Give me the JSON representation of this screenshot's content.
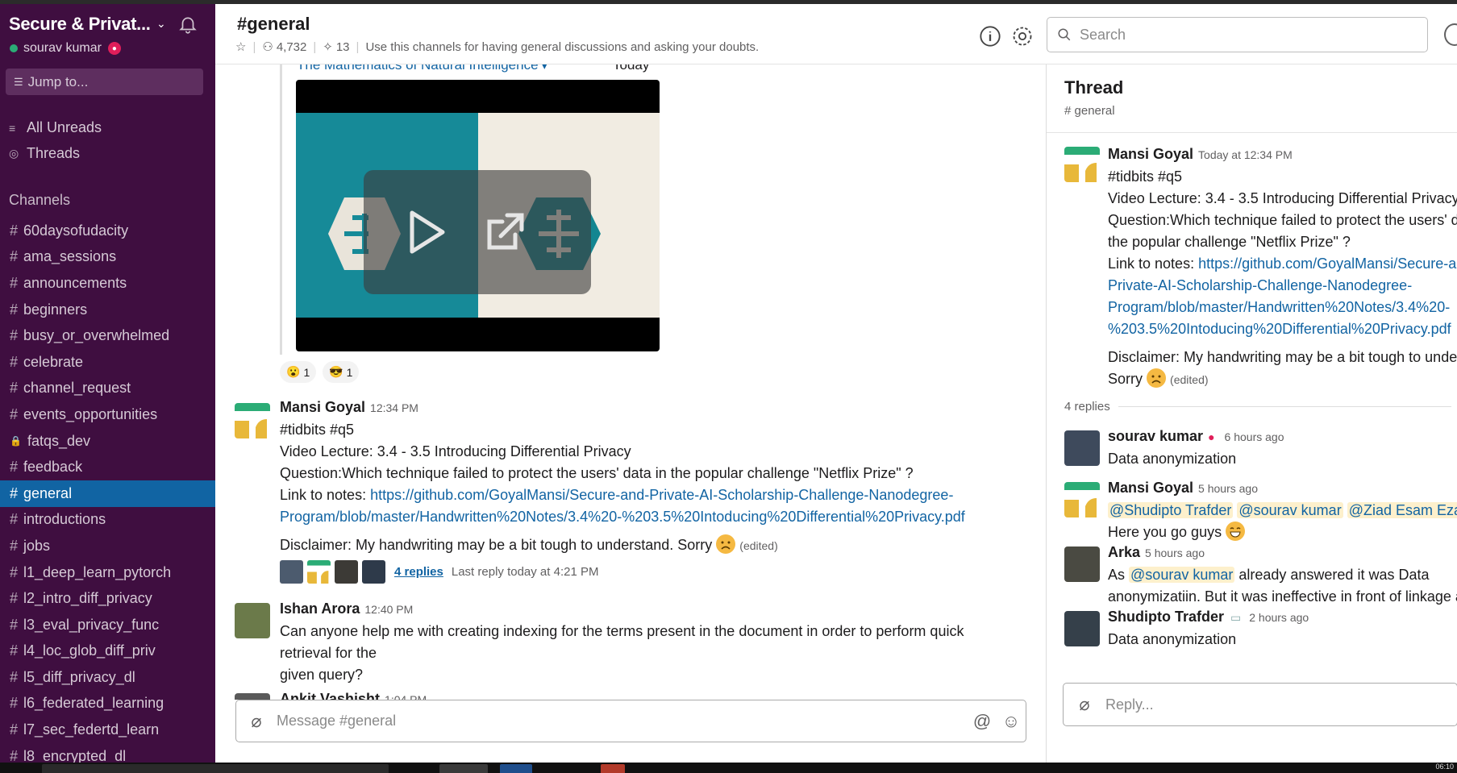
{
  "workspace": {
    "name": "Secure & Privat...",
    "user": "sourav kumar"
  },
  "sidebar": {
    "jump_label": "Jump to...",
    "nav": [
      "All Unreads",
      "Threads"
    ],
    "channels_title": "Channels",
    "channels": [
      "60daysofudacity",
      "ama_sessions",
      "announcements",
      "beginners",
      "busy_or_overwhelmed",
      "celebrate",
      "channel_request",
      "events_opportunities",
      "fatqs_dev",
      "feedback",
      "general",
      "introductions",
      "jobs",
      "l1_deep_learn_pytorch",
      "l2_intro_diff_privacy",
      "l3_eval_privacy_func",
      "l4_loc_glob_diff_priv",
      "l5_diff_privacy_dl",
      "l6_federated_learning",
      "l7_sec_federtd_learn",
      "l8_encrypted_dl"
    ],
    "active_channel": "general",
    "private_channel": "fatqs_dev"
  },
  "header": {
    "channel": "#general",
    "members": "4,732",
    "pins": "13",
    "topic": "Use this channels for having general discussions and asking your doubts.",
    "search_placeholder": "Search"
  },
  "messages": {
    "video": {
      "title": "The Mathematics of Natural Intelligence",
      "date": "Today"
    },
    "reactions": [
      {
        "emoji": "😮",
        "count": "1"
      },
      {
        "emoji": "😎",
        "count": "1"
      }
    ],
    "m1": {
      "sender": "Mansi Goyal",
      "time": "12:34 PM",
      "line1": "#tidbits #q5",
      "line2": "Video Lecture: 3.4 - 3.5 Introducing Differential Privacy",
      "line3": "Question:Which technique failed to protect the users' data in the popular challenge \"Netflix Prize\" ?",
      "link_prefix": "Link to notes: ",
      "link_a": "https://github.com/GoyalMansi/Secure-and-Private-AI-Scholarship-Challenge-Nanodegree-",
      "link_b": "Program/blob/master/Handwritten%20Notes/3.4%20-%203.5%20Intoducing%20Differential%20Privacy.pdf",
      "disclaimer": "Disclaimer: My handwriting may be a bit tough to understand. Sorry",
      "edited": "(edited)",
      "replies": "4 replies",
      "last_reply": "Last reply today at 4:21 PM"
    },
    "m2": {
      "sender": "Ishan Arora",
      "time": "12:40 PM",
      "text1": "Can anyone help me with creating indexing for the terms present in the document in order to perform quick",
      "text2": "retrieval for the",
      "text3": "given query?"
    },
    "m3": {
      "sender": "Ankit Vashisht",
      "time": "1:04 PM"
    },
    "composer_placeholder": "Message #general"
  },
  "thread": {
    "title": "Thread",
    "channel": "# general",
    "parent": {
      "sender": "Mansi Goyal",
      "time": "Today at 12:34 PM",
      "line1": "#tidbits #q5",
      "line2": "Video Lecture: 3.4 - 3.5 Introducing Differential Privacy",
      "line3": "Question:Which technique failed to protect the users' data in",
      "line4": "the popular challenge \"Netflix Prize\" ?",
      "link_prefix": "Link to notes: ",
      "link_a": "https://github.com/GoyalMansi/Secure-and-",
      "link_b": "Private-AI-Scholarship-Challenge-Nanodegree-",
      "link_c": "Program/blob/master/Handwritten%20Notes/3.4%20-",
      "link_d": "%203.5%20Intoducing%20Differential%20Privacy.pdf",
      "disclaimer": "Disclaimer: My handwriting may be a bit tough to understand.",
      "sorry": "Sorry",
      "edited": "(edited)"
    },
    "replies_count": "4 replies",
    "replies": [
      {
        "sender": "sourav kumar",
        "time": "6 hours ago",
        "text": "Data anonymization"
      },
      {
        "sender": "Mansi Goyal",
        "time": "5 hours ago",
        "mentions": [
          "@Shudipto Trafder",
          "@sourav kumar",
          "@Ziad Esam Ezat"
        ],
        "text": "Here you go guys"
      },
      {
        "sender": "Arka",
        "time": "5 hours ago",
        "pre": "As",
        "mention": "@sourav kumar",
        "post": "already answered it was Data",
        "line2": "anonymizatiin. But it was ineffective in front of linkage attack."
      },
      {
        "sender": "Shudipto Trafder",
        "time": "2 hours ago",
        "text": "Data anonymization"
      }
    ],
    "reply_placeholder": "Reply..."
  },
  "taskbar": {
    "clock": "06:10"
  },
  "colors": {
    "sidebar_bg": "#3f0e40",
    "active_channel": "#1164a3",
    "link": "#1264a3",
    "accent_green": "#2bac76"
  }
}
